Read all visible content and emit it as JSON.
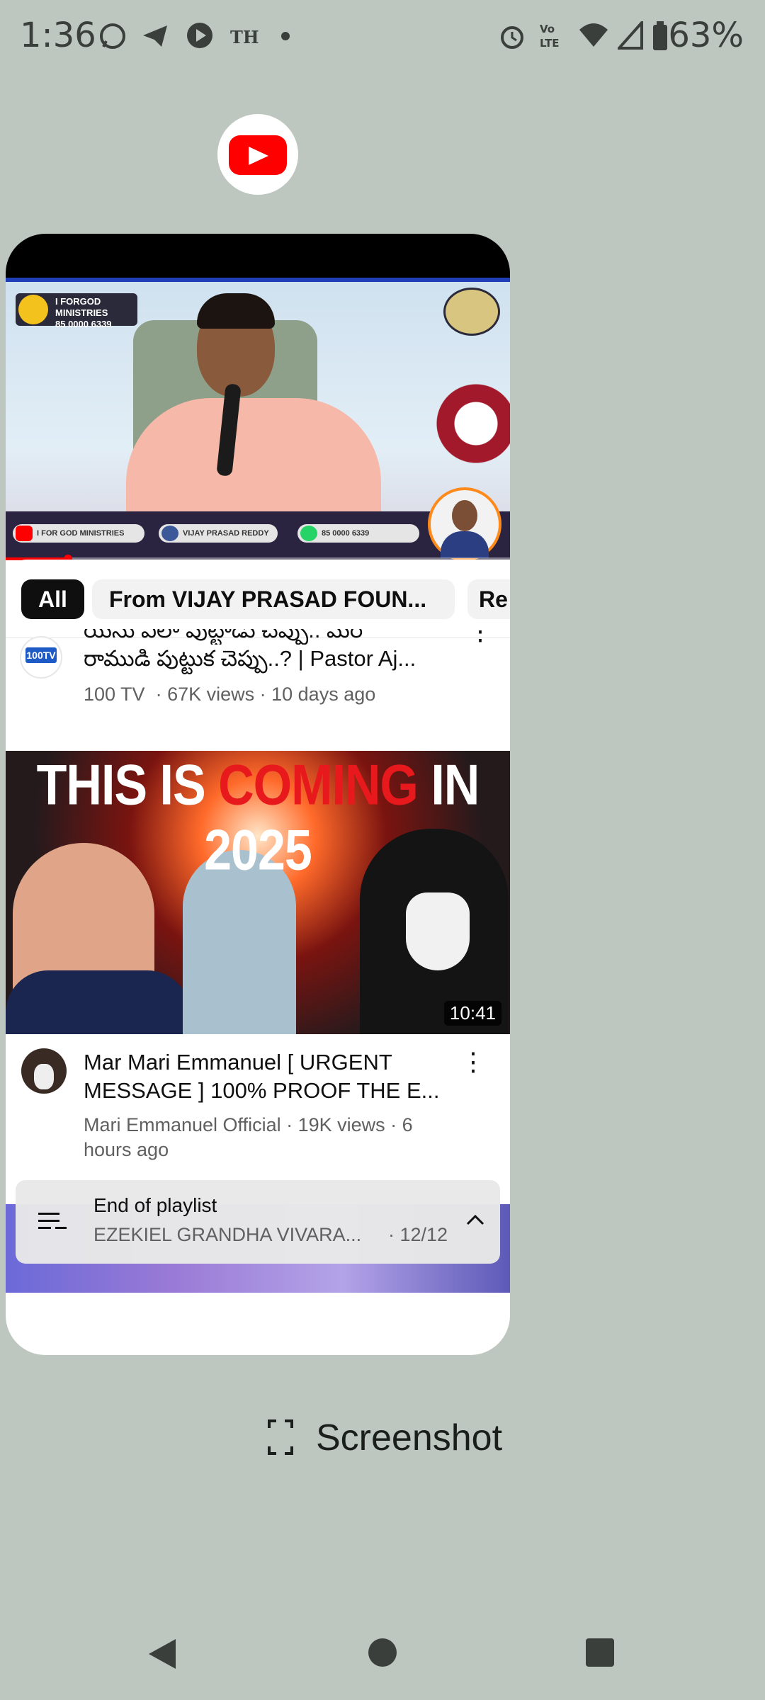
{
  "status_bar": {
    "time": "1:36",
    "carrier_badge": "TH",
    "battery": "63%",
    "icons": [
      "whatsapp-icon",
      "telegram-icon",
      "play-icon",
      "dot-icon",
      "alarm-icon",
      "volte-icon",
      "wifi-icon",
      "signal-icon",
      "battery-icon"
    ]
  },
  "recents": {
    "app_icon": "youtube-icon",
    "screenshot_label": "Screenshot"
  },
  "player": {
    "overlay_left": "I FORGOD MINISTRIES",
    "overlay_phone": "85 0000 6339",
    "pill_youtube": "I FOR GOD MINISTRIES",
    "pill_facebook": "VIJAY PRASAD REDDY",
    "pill_whatsapp": "85 0000 6339"
  },
  "chips": [
    {
      "label": "All",
      "active": true
    },
    {
      "label": "From VIJAY PRASAD FOUN...",
      "active": false
    },
    {
      "label": "Re",
      "active": false
    }
  ],
  "videos": [
    {
      "title_line1": "యేసు ఎలా పుట్టాడు చెప్పు.. మరి",
      "title_line2": "రాముడి పుట్టుక చెప్పు..? | Pastor Aj...",
      "channel": "100 TV",
      "meta": "· 67K views · 10 days ago",
      "avatar_text": "100TV"
    },
    {
      "thumb_headline_1": "THIS IS ",
      "thumb_headline_red": "COMING",
      "thumb_headline_2": " IN 2025",
      "duration": "10:41",
      "title_line1": "Mar Mari Emmanuel [ URGENT",
      "title_line2": "MESSAGE ] 100% PROOF THE E...",
      "meta_line1": "Mari Emmanuel Official · 19K views · 6",
      "meta_line2": "hours ago"
    }
  ],
  "mini_player": {
    "label": "End of playlist",
    "playlist": "EZEKIEL GRANDHA VIVARA...",
    "count": "· 12/12"
  },
  "colors": {
    "background": "#bec7bf",
    "youtube_red": "#ff0000",
    "text_secondary": "#606060"
  }
}
